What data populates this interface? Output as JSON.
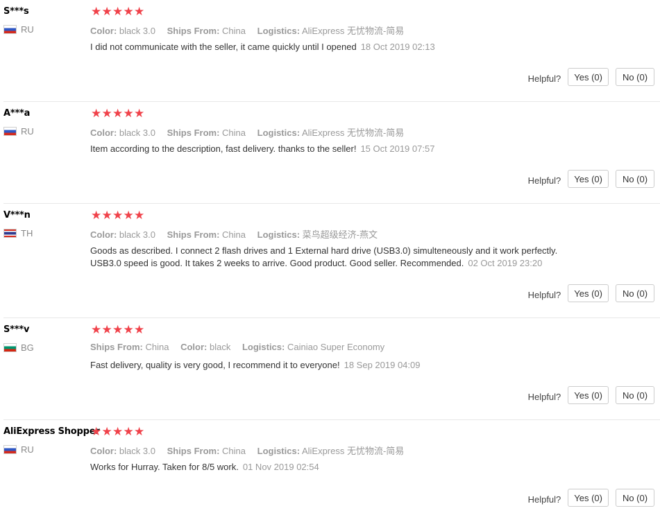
{
  "reviews": [
    {
      "user": "S***s",
      "country": "RU",
      "flag": "ru",
      "stars": 5,
      "attrs": [
        {
          "k": "Color:",
          "v": "black 3.0"
        },
        {
          "k": "Ships From:",
          "v": "China"
        },
        {
          "k": "Logistics:",
          "v": "AliExpress 无忧物流-简易"
        }
      ],
      "text": "I did not communicate with the seller, it came quickly until I opened",
      "date": "18 Oct 2019 02:13",
      "helpful_label": "Helpful?",
      "yes": "Yes (0)",
      "no": "No (0)"
    },
    {
      "user": "A***a",
      "country": "RU",
      "flag": "ru",
      "stars": 5,
      "attrs": [
        {
          "k": "Color:",
          "v": "black 3.0"
        },
        {
          "k": "Ships From:",
          "v": "China"
        },
        {
          "k": "Logistics:",
          "v": "AliExpress 无忧物流-简易"
        }
      ],
      "text": "Item according to the description, fast delivery. thanks to the seller!",
      "date": "15 Oct 2019 07:57",
      "helpful_label": "Helpful?",
      "yes": "Yes (0)",
      "no": "No (0)"
    },
    {
      "user": "V***n",
      "country": "TH",
      "flag": "th",
      "stars": 5,
      "attrs": [
        {
          "k": "Color:",
          "v": "black 3.0"
        },
        {
          "k": "Ships From:",
          "v": "China"
        },
        {
          "k": "Logistics:",
          "v": "菜鸟超级经济-燕文"
        }
      ],
      "text": "Goods as described. I connect 2 flash drives and 1 External hard drive (USB3.0) simulteneously and it work perfectly. USB3.0 speed is good. It takes 2 weeks to arrive. Good product. Good seller. Recommended.",
      "date": "02 Oct 2019 23:20",
      "helpful_label": "Helpful?",
      "yes": "Yes (0)",
      "no": "No (0)"
    },
    {
      "user": "S***v",
      "country": "BG",
      "flag": "bg",
      "stars": 5,
      "attrs": [
        {
          "k": "Ships From:",
          "v": "China"
        },
        {
          "k": "Color:",
          "v": "black"
        },
        {
          "k": "Logistics:",
          "v": "Cainiao Super Economy"
        }
      ],
      "text": "Fast delivery, quality is very good, I recommend it to everyone!",
      "date": "18 Sep 2019 04:09",
      "helpful_label": "Helpful?",
      "yes": "Yes (0)",
      "no": "No (0)"
    },
    {
      "user": "AliExpress Shopper",
      "country": "RU",
      "flag": "ru",
      "stars": 5,
      "attrs": [
        {
          "k": "Color:",
          "v": "black 3.0"
        },
        {
          "k": "Ships From:",
          "v": "China"
        },
        {
          "k": "Logistics:",
          "v": "AliExpress 无忧物流-简易"
        }
      ],
      "text": "Works for Hurray. Taken for 8/5 work.",
      "date": "01 Nov 2019 02:54",
      "helpful_label": "Helpful?",
      "yes": "Yes (0)",
      "no": "No (0)"
    }
  ],
  "colors": {
    "star": "#f0424a",
    "muted": "#999999",
    "border": "#cccccc"
  },
  "icons": {
    "star": "star-icon",
    "flag": "flag-icon"
  }
}
